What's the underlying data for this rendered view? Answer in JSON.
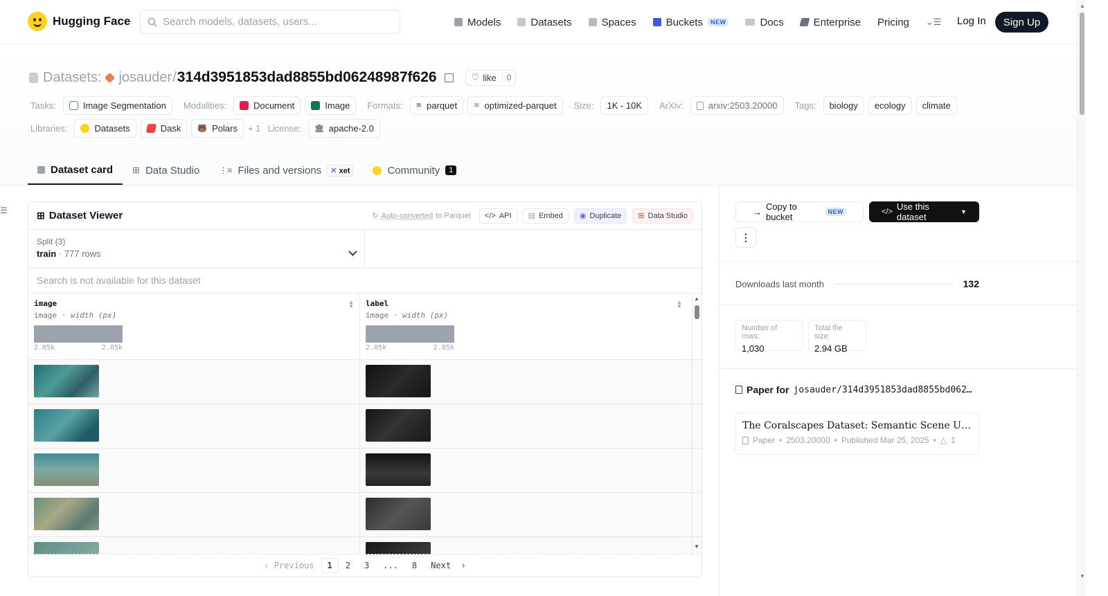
{
  "header": {
    "brand": "Hugging Face",
    "search_placeholder": "Search models, datasets, users...",
    "nav": [
      {
        "label": "Models",
        "icon": "cube-icon"
      },
      {
        "label": "Datasets",
        "icon": "database-icon"
      },
      {
        "label": "Spaces",
        "icon": "grid-icon"
      },
      {
        "label": "Buckets",
        "icon": "bucket-icon",
        "badge": "NEW"
      },
      {
        "label": "Docs",
        "icon": "book-icon"
      },
      {
        "label": "Enterprise",
        "icon": "enterprise-icon"
      },
      {
        "label": "Pricing"
      }
    ],
    "login": "Log In",
    "signup": "Sign Up"
  },
  "repo": {
    "section": "Datasets:",
    "owner": "josauder",
    "slash": "/",
    "name": "314d3951853dad8855bd06248987f626",
    "like_label": "like",
    "like_count": "0"
  },
  "tags": {
    "tasks_label": "Tasks:",
    "tasks": [
      "Image Segmentation"
    ],
    "modalities_label": "Modalities:",
    "modalities": [
      "Document",
      "Image"
    ],
    "formats_label": "Formats:",
    "formats": [
      "parquet",
      "optimized-parquet"
    ],
    "size_label": "Size:",
    "size": "1K - 10K",
    "arxiv_label": "ArXiv:",
    "arxiv": "arxiv:2503.20000",
    "tags_label": "Tags:",
    "tags": [
      "biology",
      "ecology",
      "climate"
    ],
    "libraries_label": "Libraries:",
    "libraries": [
      "Datasets",
      "Dask",
      "Polars"
    ],
    "libraries_more": "+ 1",
    "license_label": "License:",
    "license": "apache-2.0"
  },
  "tabs": [
    {
      "label": "Dataset card",
      "active": true
    },
    {
      "label": "Data Studio"
    },
    {
      "label": "Files and versions",
      "badge": "xet"
    },
    {
      "label": "Community",
      "count": "1"
    }
  ],
  "viewer": {
    "title": "Dataset Viewer",
    "auto_converted": "Auto-converted",
    "to_parquet": "to Parquet",
    "actions": [
      "API",
      "Embed",
      "Duplicate",
      "Data Studio"
    ],
    "split_label": "Split (3)",
    "split_name": "train",
    "split_rows": "777 rows",
    "search_na": "Search is not available for this dataset",
    "columns": [
      {
        "name": "image",
        "type": "image",
        "stat": "width (px)",
        "min": "2.05k",
        "max": "2.05k"
      },
      {
        "name": "label",
        "type": "image",
        "stat": "width (px)",
        "min": "2.05k",
        "max": "2.05k"
      }
    ],
    "pager": {
      "prev": "Previous",
      "pages": [
        "1",
        "2",
        "3",
        "...",
        "8"
      ],
      "next": "Next"
    }
  },
  "sidebar": {
    "copy_bucket": "Copy to bucket",
    "copy_bucket_badge": "NEW",
    "use_dataset": "Use this dataset",
    "downloads_label": "Downloads last month",
    "downloads": "132",
    "rows_label": "Number of rows:",
    "rows": "1,030",
    "size_label": "Total file size:",
    "size": "2.94 GB",
    "paper_for": "Paper for",
    "paper_repo": "josauder/314d3951853dad8855bd062…",
    "paper_title": "The Coralscapes Dataset: Semantic Scene Underst…",
    "paper_kind": "Paper",
    "paper_id": "2503.20000",
    "paper_published": "Published Mar 25, 2025",
    "paper_upvotes": "1"
  }
}
